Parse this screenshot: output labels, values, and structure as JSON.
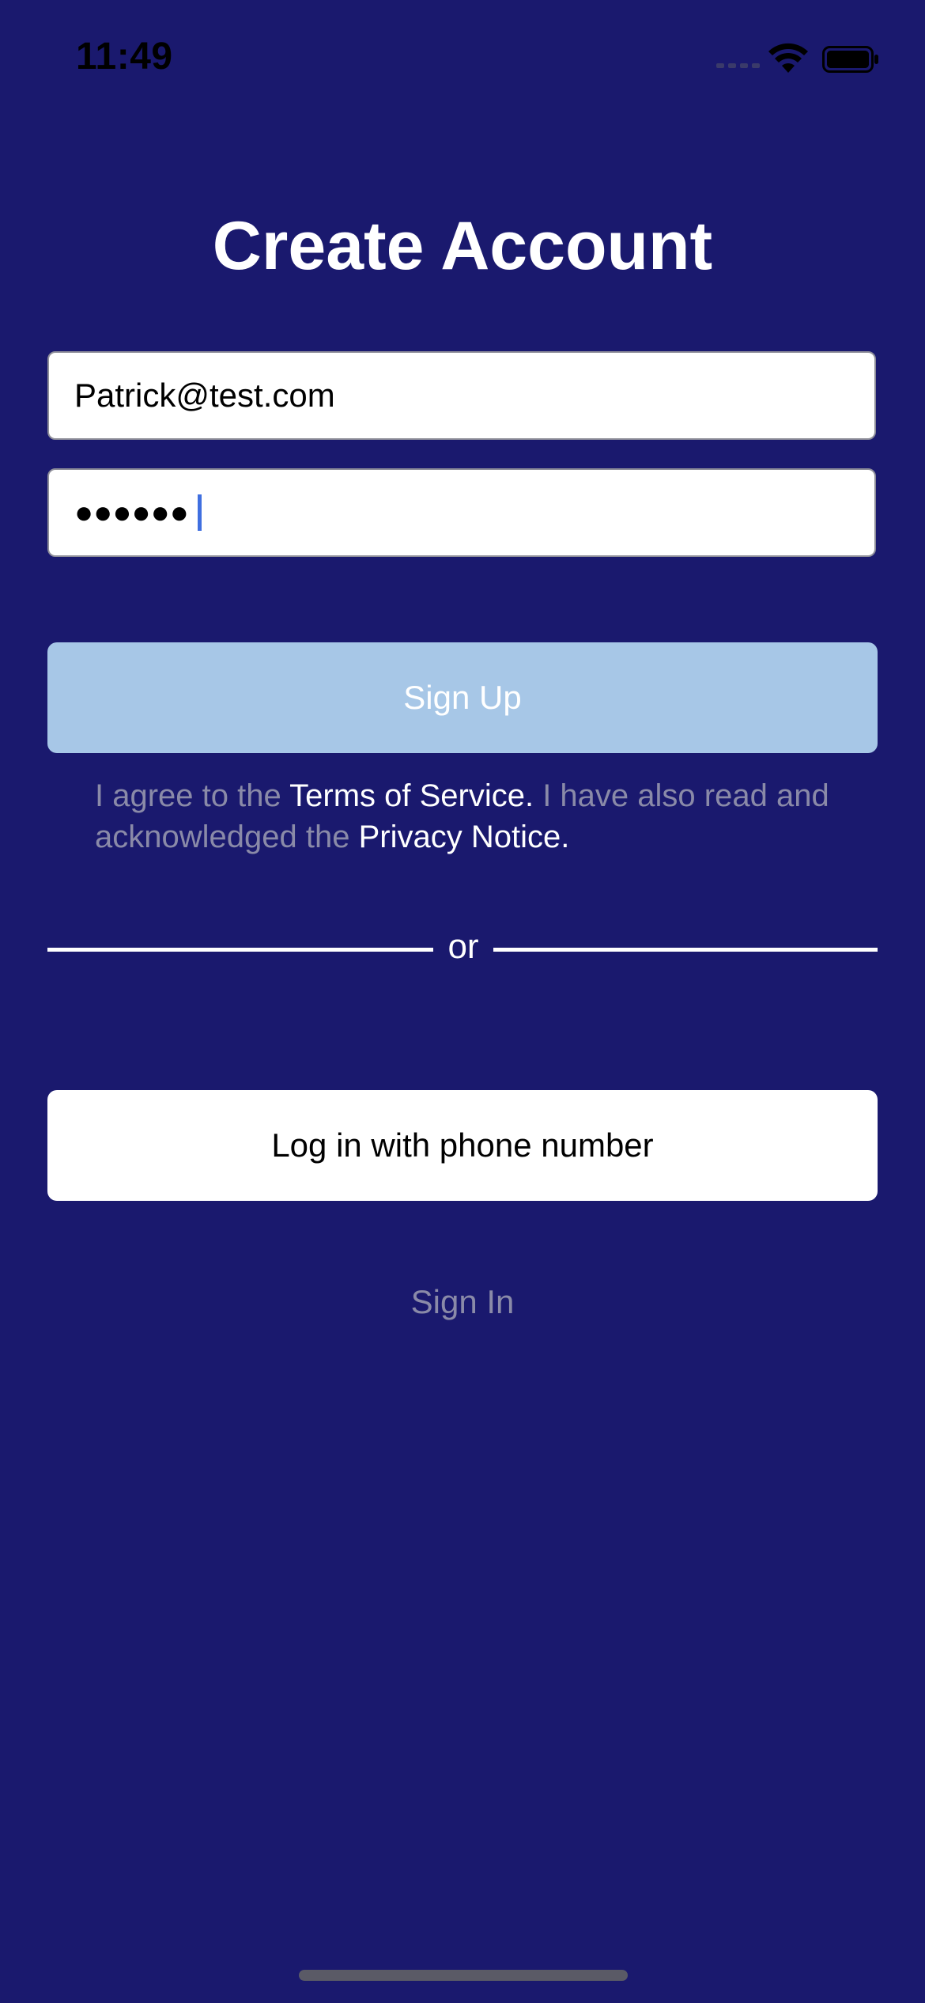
{
  "status_bar": {
    "time": "11:49"
  },
  "screen": {
    "title": "Create Account"
  },
  "form": {
    "email_value": "Patrick@test.com",
    "password_mask": "●●●●●●"
  },
  "signup_button": {
    "label": "Sign Up"
  },
  "legal": {
    "part1": "I agree to the ",
    "terms_link": "Terms of Service.",
    "part2": " I have also read and acknowledged the ",
    "privacy_link": "Privacy Notice."
  },
  "divider": {
    "label": "or"
  },
  "phone_login_button": {
    "label": "Log in with phone number"
  },
  "sign_in_link": {
    "label": "Sign In"
  },
  "colors": {
    "background": "#1a196e",
    "signup_button": "#a7c7e7",
    "muted_text": "#8a8aa8",
    "caret": "#3f6fe0"
  }
}
